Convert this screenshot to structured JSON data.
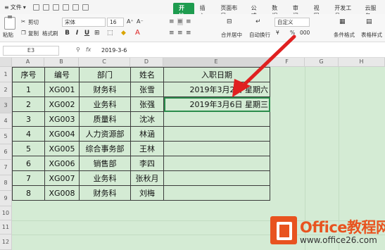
{
  "menubar": {
    "file_label": "文件",
    "tabs": [
      "开始",
      "插入",
      "页面布局",
      "公式",
      "数据",
      "审阅",
      "视图",
      "开发工具",
      "云服务"
    ]
  },
  "ribbon": {
    "paste": "粘贴",
    "cut": "剪切",
    "copy": "复制",
    "format_painter": "格式刷",
    "font_name": "宋体",
    "font_size": "16",
    "bold": "B",
    "italic": "I",
    "underline": "U",
    "merge_center": "合并居中",
    "wrap_text": "自动换行",
    "number_format": "自定义",
    "currency": "¥",
    "percent": "%",
    "thousands": "000",
    "cond_format": "条件格式",
    "table_style": "表格样式"
  },
  "formula_bar": {
    "name_box": "E3",
    "fx": "fx",
    "value": "2019-3-6"
  },
  "sheet": {
    "columns": [
      "A",
      "B",
      "C",
      "D",
      "E",
      "F",
      "G",
      "H"
    ],
    "rows": [
      "1",
      "2",
      "3",
      "4",
      "5",
      "6",
      "7",
      "8",
      "9",
      "10",
      "11",
      "12"
    ],
    "headers": [
      "序号",
      "编号",
      "部门",
      "姓名",
      "入职日期"
    ],
    "records": [
      [
        "1",
        "XG001",
        "财务科",
        "张雪",
        "2019年3月2日  星期六"
      ],
      [
        "2",
        "XG002",
        "业务科",
        "张强",
        "2019年3月6日  星期三"
      ],
      [
        "3",
        "XG003",
        "质量科",
        "沈冰",
        ""
      ],
      [
        "4",
        "XG004",
        "人力资源部",
        "林涵",
        ""
      ],
      [
        "5",
        "XG005",
        "综合事务部",
        "王林",
        ""
      ],
      [
        "6",
        "XG006",
        "销售部",
        "李四",
        ""
      ],
      [
        "7",
        "XG007",
        "业务科",
        "张秋月",
        ""
      ],
      [
        "8",
        "XG008",
        "财务科",
        "刘梅",
        ""
      ]
    ]
  },
  "watermark": {
    "title": "Office教程网",
    "url": "www.office26.com"
  }
}
